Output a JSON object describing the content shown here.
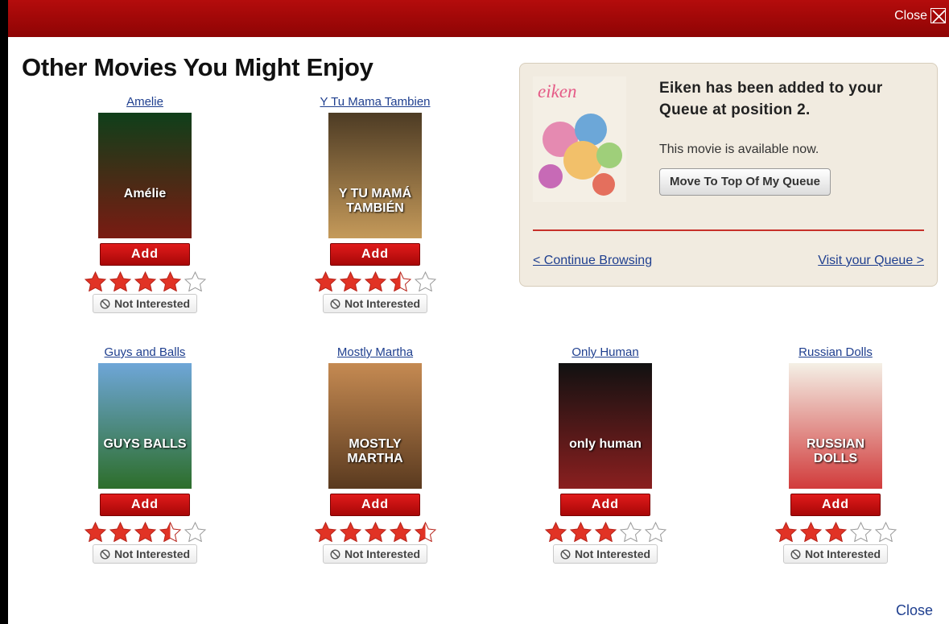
{
  "topbar": {
    "close_label": "Close"
  },
  "heading": "Other Movies You Might Enjoy",
  "movies": [
    {
      "title": "Amelie",
      "poster_text": "Amélie",
      "rating": 4,
      "poster_colors": [
        "#0f3f1a",
        "#7a1b12"
      ]
    },
    {
      "title": "Y Tu Mama Tambien",
      "poster_text": "Y TU MAMÁ TAMBIÉN",
      "rating": 3.5,
      "poster_colors": [
        "#4d3b24",
        "#c59a5a"
      ]
    },
    {
      "title": "Guys and Balls",
      "poster_text": "GUYS BALLS",
      "rating": 3.5,
      "poster_colors": [
        "#6ea6d8",
        "#2d6e2a"
      ]
    },
    {
      "title": "Mostly Martha",
      "poster_text": "MOSTLY MARTHA",
      "rating": 4.5,
      "poster_colors": [
        "#c58a52",
        "#5a3a1f"
      ]
    },
    {
      "title": "Only Human",
      "poster_text": "only human",
      "rating": 3,
      "poster_colors": [
        "#111111",
        "#8a1f1f"
      ]
    },
    {
      "title": "Russian Dolls",
      "poster_text": "RUSSIAN DOLLS",
      "rating": 3,
      "poster_colors": [
        "#f4f0e6",
        "#d13b3b"
      ]
    }
  ],
  "buttons": {
    "add_label": "Add",
    "not_interested_label": "Not Interested"
  },
  "confirmation": {
    "poster_text": "eiken",
    "message": "Eiken has been added to your Queue at position 2.",
    "availability": "This movie is available now.",
    "move_button": "Move To Top Of My Queue",
    "continue_link": "< Continue Browsing",
    "queue_link": "Visit your Queue >"
  },
  "footer": {
    "close_label": "Close"
  },
  "colors": {
    "brand_red": "#b40c0c",
    "star": "#e13325",
    "link": "#1f3f8f"
  }
}
